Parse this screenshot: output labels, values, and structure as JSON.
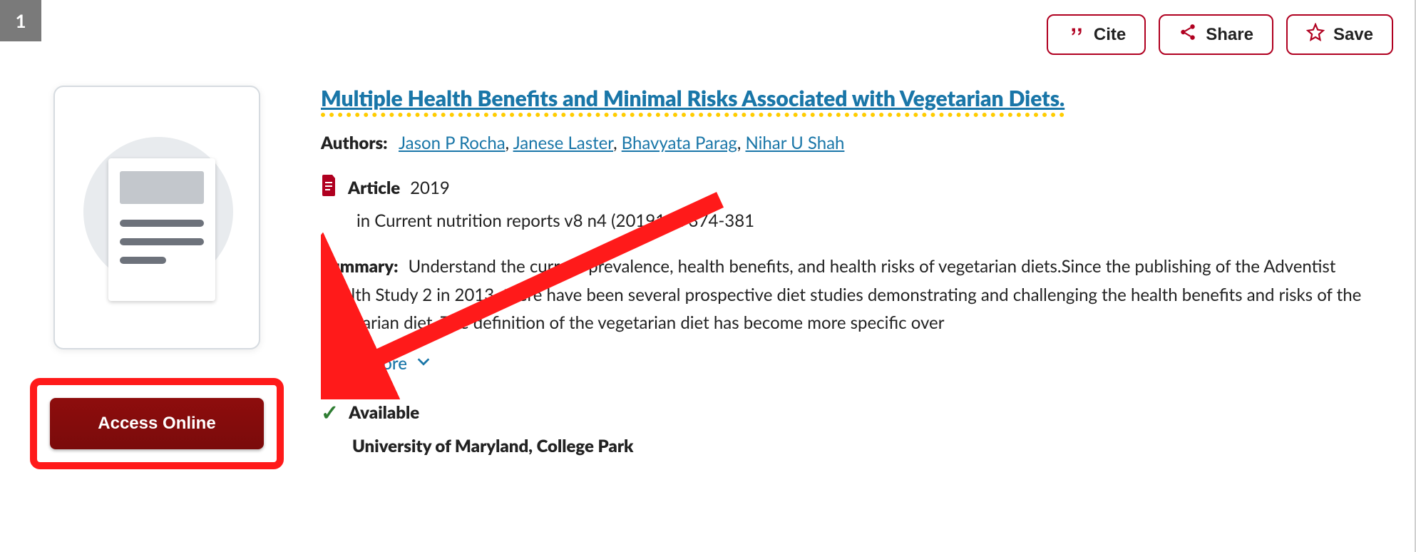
{
  "result_number": "1",
  "actions": {
    "cite": "Cite",
    "share": "Share",
    "save": "Save"
  },
  "access_button": "Access Online",
  "title": "Multiple Health Benefits and Minimal Risks Associated with Vegetarian Diets.",
  "authors_label": "Authors:",
  "authors": [
    "Jason P Rocha",
    "Janese Laster",
    "Bhavyata Parag",
    "Nihar U Shah"
  ],
  "type_label": "Article",
  "year": "2019",
  "publication_line": "in Current nutrition reports  v8 n4 (201912): 374-381",
  "summary_label": "Summary:",
  "summary_text": "Understand the current prevalence, health benefits, and health risks of vegetarian diets.Since the publishing of the Adventist Health Study 2 in 2013, there have been several prospective diet studies demonstrating and challenging the health benefits and risks of the vegetarian diet. The definition of the vegetarian diet has become more specific over",
  "show_more": "Show More",
  "availability_label": "Available",
  "institution": "University of Maryland, College Park"
}
